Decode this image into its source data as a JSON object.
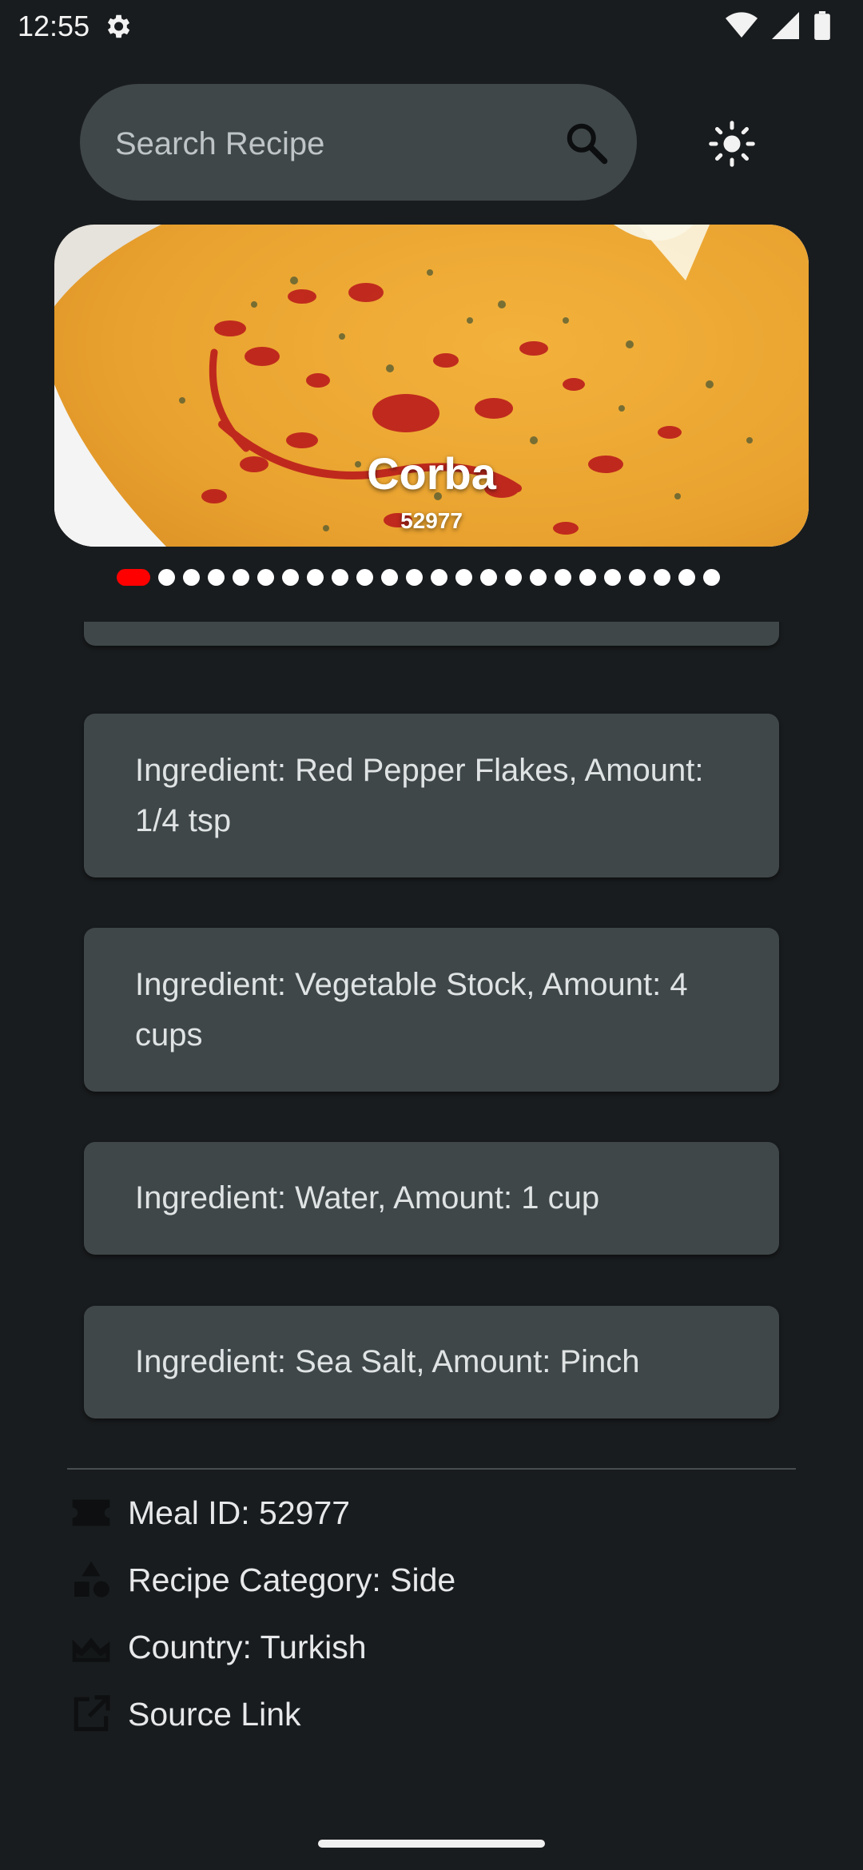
{
  "status_bar": {
    "time": "12:55"
  },
  "search": {
    "placeholder": "Search Recipe",
    "value": ""
  },
  "carousel": {
    "title": "Corba",
    "subtitle": "52977",
    "dots_total": 24,
    "active_index": 0,
    "active_color": "#ff0000"
  },
  "ingredients": [
    {
      "text": "Ingredient: Red Pepper Flakes, Amount: 1/4 tsp"
    },
    {
      "text": "Ingredient: Vegetable Stock, Amount: 4 cups"
    },
    {
      "text": "Ingredient: Water, Amount: 1 cup"
    },
    {
      "text": "Ingredient: Sea Salt, Amount: Pinch"
    }
  ],
  "details": {
    "meal_id": "Meal ID: 52977",
    "category": "Recipe Category: Side",
    "country": "Country: Turkish",
    "source": "Source Link"
  },
  "icons": {
    "search": "search-icon",
    "theme": "sun-icon",
    "meal_id": "ticket-icon",
    "category": "category-shapes-icon",
    "country": "landscape-icon",
    "source": "open-in-new-icon"
  },
  "colors": {
    "background": "#191c1e",
    "card": "#3f4748",
    "accent": "#ff0000"
  }
}
